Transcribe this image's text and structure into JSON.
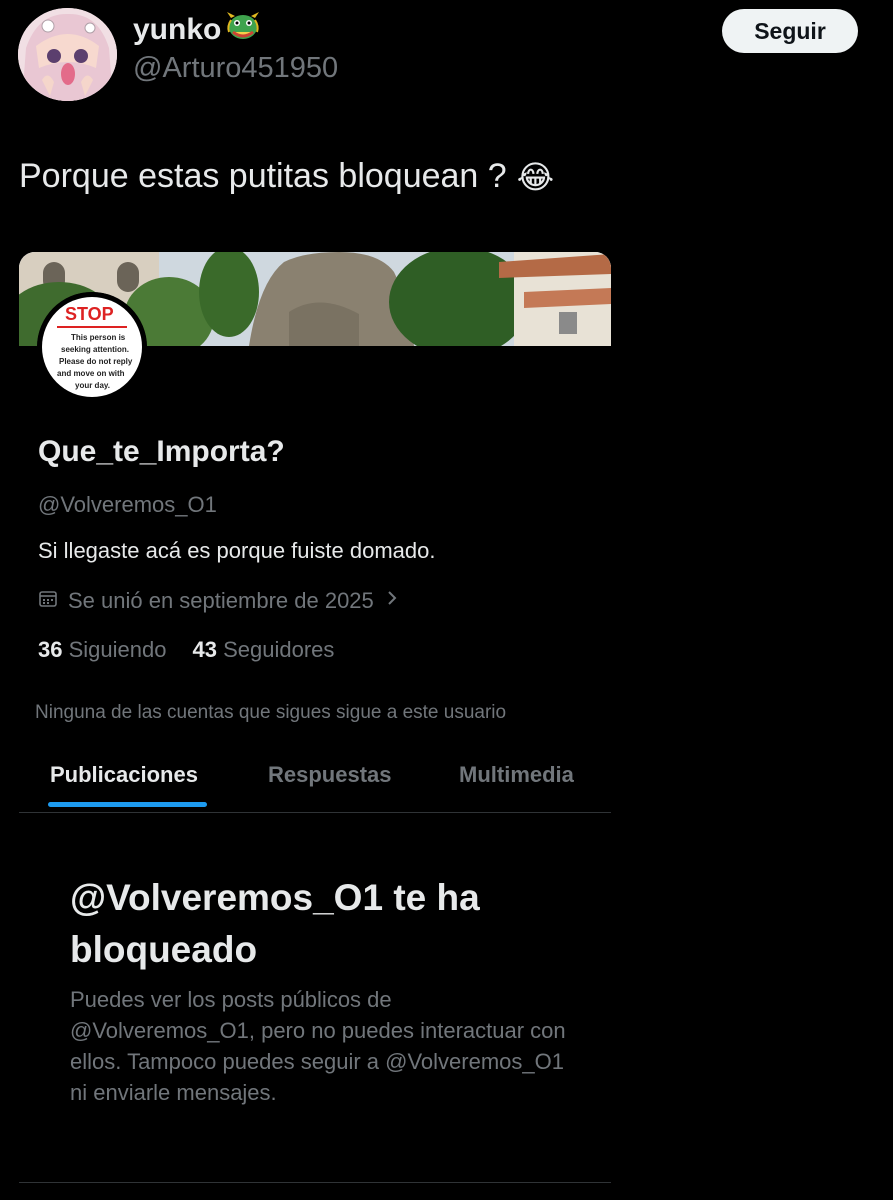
{
  "tweet": {
    "author_name": "yunko",
    "author_handle": "@Arturo451950",
    "follow_label": "Seguir",
    "text": "Porque estas putitas bloquean ?",
    "emoji": "😂"
  },
  "embedded_profile": {
    "avatar_sign": {
      "title": "STOP",
      "text": "This person is seeking attention. Please do not reply and move on with your day."
    },
    "name": "Que_te_Importa?",
    "handle": "@Volveremos_O1",
    "bio": "Si llegaste acá es porque fuiste domado.",
    "joined": "Se unió en septiembre de 2025",
    "following_count": "36",
    "following_label": "Siguiendo",
    "followers_count": "43",
    "followers_label": "Seguidores",
    "mutuals_note": "Ninguna de las cuentas que sigues sigue a este usuario",
    "tabs": [
      "Publicaciones",
      "Respuestas",
      "Multimedia"
    ],
    "active_tab": "Publicaciones",
    "blocked_title": "@Volveremos_O1 te ha bloqueado",
    "blocked_description": "Puedes ver los posts públicos de @Volveremos_O1, pero no puedes interactuar con ellos. Tampoco puedes seguir a @Volveremos_O1 ni enviarle mensajes."
  },
  "colors": {
    "background": "#000000",
    "primary_text": "#e7e9ea",
    "secondary_text": "#71767b",
    "accent": "#1d9bf0",
    "divider": "#2f3336"
  }
}
